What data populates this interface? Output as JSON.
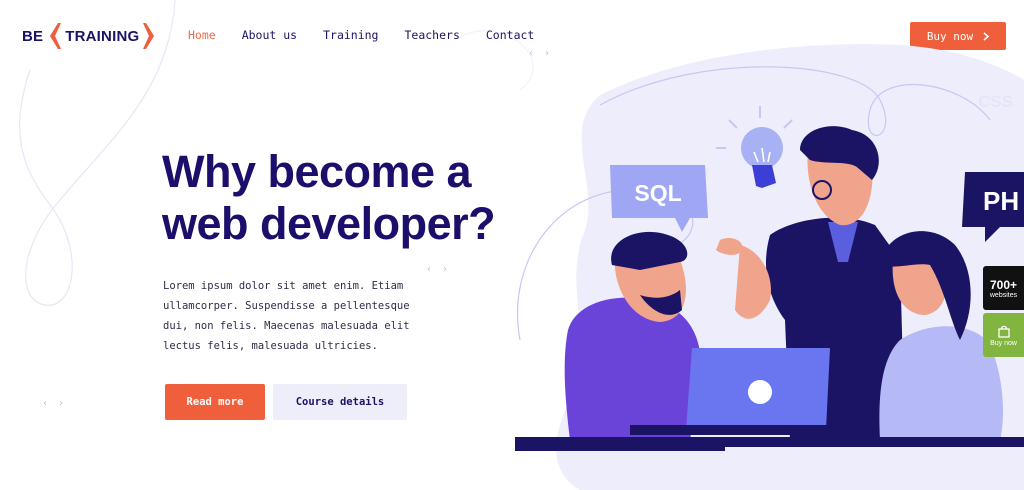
{
  "brand": {
    "left": "BE",
    "right": "TRAINING",
    "accent_color": "#ef5f3c",
    "text_color": "#1b1464"
  },
  "nav": {
    "items": [
      "Home",
      "About us",
      "Training",
      "Teachers",
      "Contact"
    ],
    "active": "Home"
  },
  "header_cta": {
    "label": "Buy now",
    "icon": "chevron-right-icon"
  },
  "hero": {
    "title": "Why become a web developer?",
    "text": "Lorem ipsum dolor sit amet enim. Etiam ullamcorper. Suspendisse a pellentesque dui, non felis. Maecenas malesuada elit lectus felis, malesuada ultricies.",
    "primary_button": "Read more",
    "secondary_button": "Course details"
  },
  "illustration": {
    "bubbles": [
      "SQL",
      "PH",
      "CSS"
    ]
  },
  "side_widgets": {
    "sites_count": "700+",
    "sites_label": "websites",
    "buy_label": "Buy now"
  },
  "code_glyphs": [
    "‹ ›",
    "‹ ›",
    "‹ ›"
  ],
  "colors": {
    "accent": "#ef5f3c",
    "navy": "#1b0f6b",
    "lavender": "#eeeefb",
    "violet": "#6a5ff0",
    "envato_green": "#82b440"
  }
}
